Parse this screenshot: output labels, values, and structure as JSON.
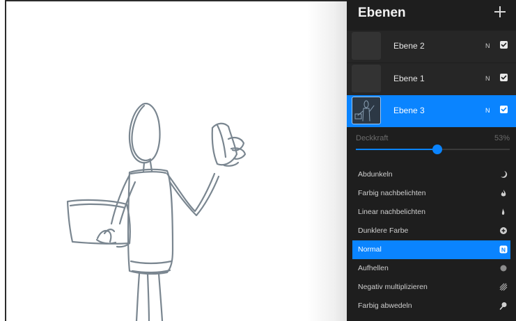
{
  "layers_panel": {
    "title": "Ebenen",
    "add_icon": "plus-icon",
    "layers": [
      {
        "name": "Ebene 2",
        "mode": "N",
        "visible": true,
        "selected": false
      },
      {
        "name": "Ebene 1",
        "mode": "N",
        "visible": true,
        "selected": false
      },
      {
        "name": "Ebene 3",
        "mode": "N",
        "visible": true,
        "selected": true
      }
    ],
    "opacity": {
      "label": "Deckkraft",
      "value_text": "53%",
      "value": 0.53
    },
    "blend_modes": [
      {
        "label": "Abdunkeln",
        "icon": "moon-icon",
        "selected": false
      },
      {
        "label": "Farbig nachbelichten",
        "icon": "burn-icon",
        "selected": false
      },
      {
        "label": "Linear nachbelichten",
        "icon": "flame-icon",
        "selected": false
      },
      {
        "label": "Dunklere Farbe",
        "icon": "plus-circle-icon",
        "selected": false
      },
      {
        "label": "Normal",
        "icon": "n-badge-icon",
        "selected": true
      },
      {
        "label": "Aufhellen",
        "icon": "circle-icon",
        "selected": false
      },
      {
        "label": "Negativ multiplizieren",
        "icon": "hatch-icon",
        "selected": false
      },
      {
        "label": "Farbig abwedeln",
        "icon": "dodge-icon",
        "selected": false
      }
    ]
  },
  "colors": {
    "panel_bg": "#1e1e1e",
    "accent": "#0a84ff",
    "sketch_stroke": "#7a8690"
  }
}
